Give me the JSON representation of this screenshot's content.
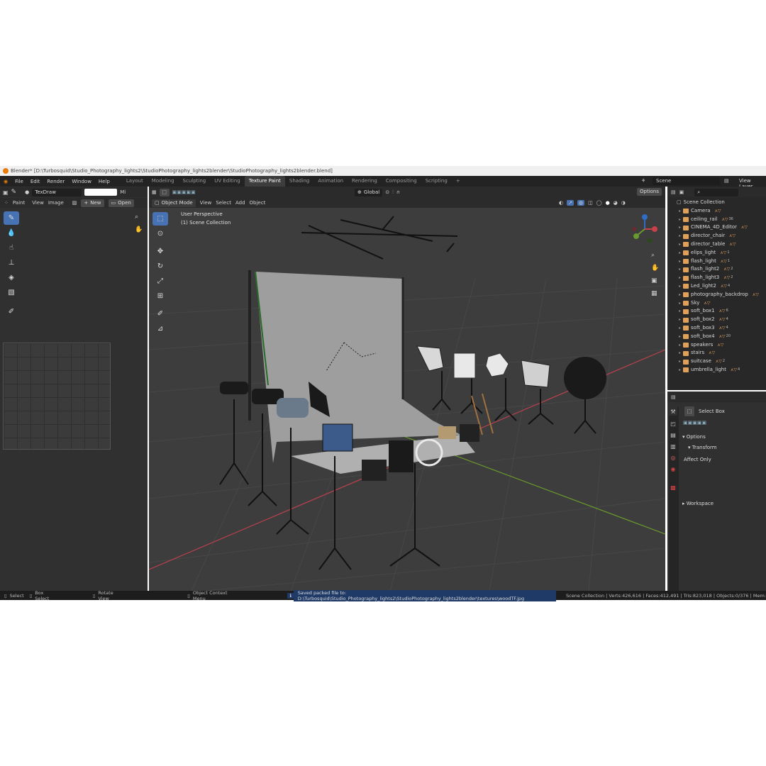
{
  "window": {
    "title": "Blender* [D:\\Turbosquid\\Studio_Photography_lights2\\StudioPhotography_lights2blender\\StudioPhotography_lights2blender.blend]"
  },
  "menu": {
    "items": [
      "File",
      "Edit",
      "Render",
      "Window",
      "Help"
    ]
  },
  "workspaces": {
    "tabs": [
      "Layout",
      "Modeling",
      "Sculpting",
      "UV Editing",
      "Texture Paint",
      "Shading",
      "Animation",
      "Rendering",
      "Compositing",
      "Scripting"
    ],
    "active": "Texture Paint",
    "add": "+"
  },
  "scene": {
    "name": "Scene",
    "view_layer": "View Layer"
  },
  "image_editor": {
    "brush_name": "TexDraw",
    "mix_label": "Mi",
    "mode_label": "Paint",
    "view_label": "View",
    "image_label": "Image",
    "new_label": "New",
    "open_label": "Open"
  },
  "viewport": {
    "mode": "Object Mode",
    "menus": [
      "View",
      "Select",
      "Add",
      "Object"
    ],
    "transform_orientation": "Global",
    "options": "Options",
    "perspective": "User Perspective",
    "collection": "(1) Scene Collection"
  },
  "outliner": {
    "root": "Scene Collection",
    "items": [
      {
        "name": "Camera",
        "badge": ""
      },
      {
        "name": "ceiling_rail",
        "badge": "36"
      },
      {
        "name": "CINEMA_4D_Editor",
        "badge": ""
      },
      {
        "name": "director_chair",
        "badge": ""
      },
      {
        "name": "director_table",
        "badge": ""
      },
      {
        "name": "elips_light",
        "badge": "1"
      },
      {
        "name": "flash_light",
        "badge": "1"
      },
      {
        "name": "flash_light2",
        "badge": "2"
      },
      {
        "name": "flash_light3",
        "badge": "2"
      },
      {
        "name": "Led_light2",
        "badge": "4"
      },
      {
        "name": "photography_backdrop",
        "badge": ""
      },
      {
        "name": "Sky",
        "badge": ""
      },
      {
        "name": "soft_box1",
        "badge": "6"
      },
      {
        "name": "soft_box2",
        "badge": "4"
      },
      {
        "name": "soft_box3",
        "badge": "4"
      },
      {
        "name": "soft_box4",
        "badge": "20"
      },
      {
        "name": "speakers",
        "badge": ""
      },
      {
        "name": "stairs",
        "badge": ""
      },
      {
        "name": "suitcase",
        "badge": "2"
      },
      {
        "name": "umbrella_light",
        "badge": "4"
      }
    ]
  },
  "properties": {
    "tool_name": "Select Box",
    "options_label": "Options",
    "transform_label": "Transform",
    "affect_only": "Affect Only",
    "workspace_label": "Workspace"
  },
  "status": {
    "select": "Select",
    "box_select": "Box Select",
    "rotate_view": "Rotate View",
    "context_menu": "Object Context Menu",
    "message": "Saved packed file to: D:\\Turbosquid\\Studio_Photography_lights2\\StudioPhotography_lights2blender\\textures\\woodTF.jpg",
    "stats": "Scene Collection | Verts:426,616 | Faces:412,491 | Tris:823,018 | Objects:0/376 | Mem:"
  },
  "colors": {
    "accent": "#4772b3",
    "header": "#232323",
    "panel": "#303030",
    "viewport": "#3d3d3d",
    "x_axis": "#b8414d",
    "y_axis": "#6a9a2d"
  }
}
